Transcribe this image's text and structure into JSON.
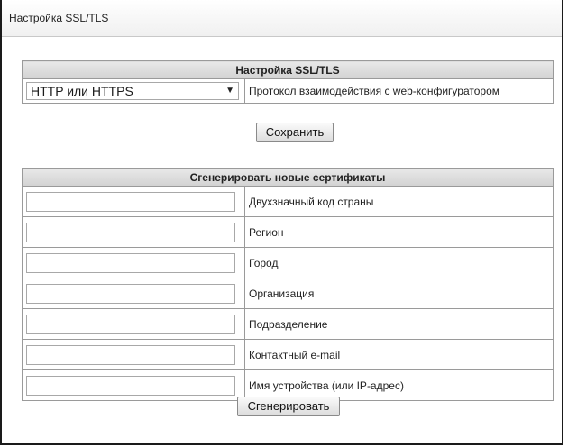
{
  "panel": {
    "title": "Настройка SSL/TLS"
  },
  "ssl_section": {
    "header": "Настройка SSL/TLS",
    "protocol_select": {
      "value": "HTTP или HTTPS",
      "arrow": "▼"
    },
    "protocol_label": "Протокол взаимодействия с web-конфигуратором",
    "save_button": "Сохранить"
  },
  "cert_section": {
    "header": "Сгенерировать новые сертификаты",
    "fields": [
      {
        "label": "Двухзначный код страны",
        "value": ""
      },
      {
        "label": "Регион",
        "value": ""
      },
      {
        "label": "Город",
        "value": ""
      },
      {
        "label": "Организация",
        "value": ""
      },
      {
        "label": "Подразделение",
        "value": ""
      },
      {
        "label": "Контактный e-mail",
        "value": ""
      },
      {
        "label": "Имя устройства (или IP-адрес)",
        "value": ""
      }
    ],
    "generate_button": "Сгенерировать"
  }
}
